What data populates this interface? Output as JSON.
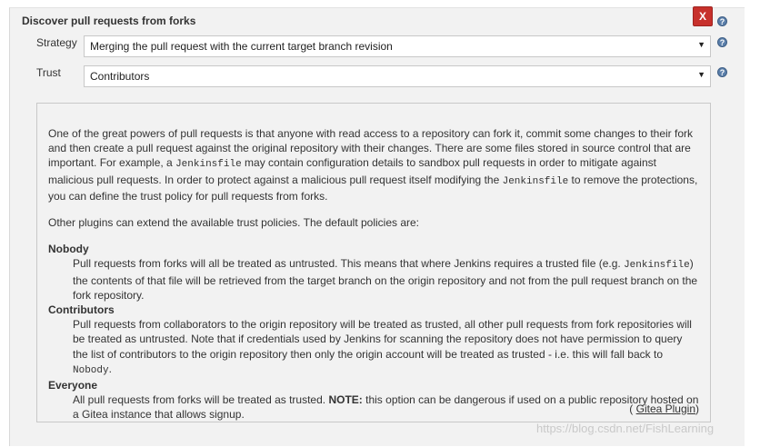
{
  "section": {
    "title": "Discover pull requests from forks",
    "close_label": "X"
  },
  "fields": {
    "strategy": {
      "label": "Strategy",
      "value": "Merging the pull request with the current target branch revision"
    },
    "trust": {
      "label": "Trust",
      "value": "Contributors"
    }
  },
  "help": {
    "intro_parts": [
      "One of the great powers of pull requests is that anyone with read access to a repository can fork it, commit some changes to their fork and then create a pull request against the original repository with their changes. There are some files stored in source control that are important. For example, a ",
      "Jenkinsfile",
      " may contain configuration details to sandbox pull requests in order to mitigate against malicious pull requests. In order to protect against a malicious pull request itself modifying the ",
      "Jenkinsfile",
      " to remove the protections, you can define the trust policy for pull requests from forks."
    ],
    "plugins_text": "Other plugins can extend the available trust policies. The default policies are:",
    "nobody": {
      "term": "Nobody",
      "desc_1": "Pull requests from forks will all be treated as untrusted. This means that where Jenkins requires a trusted file (e.g. ",
      "code": "Jenkinsfile",
      "desc_2": ") the contents of that file will be retrieved from the target branch on the origin repository and not from the pull request branch on the fork repository."
    },
    "contributors": {
      "term": "Contributors",
      "desc_1": "Pull requests from collaborators to the origin repository will be treated as trusted, all other pull requests from fork repositories will be treated as untrusted. Note that if credentials used by Jenkins for scanning the repository does not have permission to query the list of contributors to the origin repository then only the origin account will be treated as trusted - i.e. this will fall back to ",
      "code": "Nobody",
      "desc_2": "."
    },
    "everyone": {
      "term": "Everyone",
      "desc_1": "All pull requests from forks will be treated as trusted. ",
      "note": "NOTE:",
      "desc_2": " this option can be dangerous if used on a public repository hosted on a Gitea instance that allows signup."
    },
    "plugin_prefix": "(",
    "plugin_link": "Gitea Plugin",
    "plugin_suffix": ")"
  },
  "watermark": "https://blog.csdn.net/FishLearning",
  "icons": {
    "help": "question-circle-icon",
    "dropdown": "caret-down-icon",
    "close": "close-icon"
  }
}
